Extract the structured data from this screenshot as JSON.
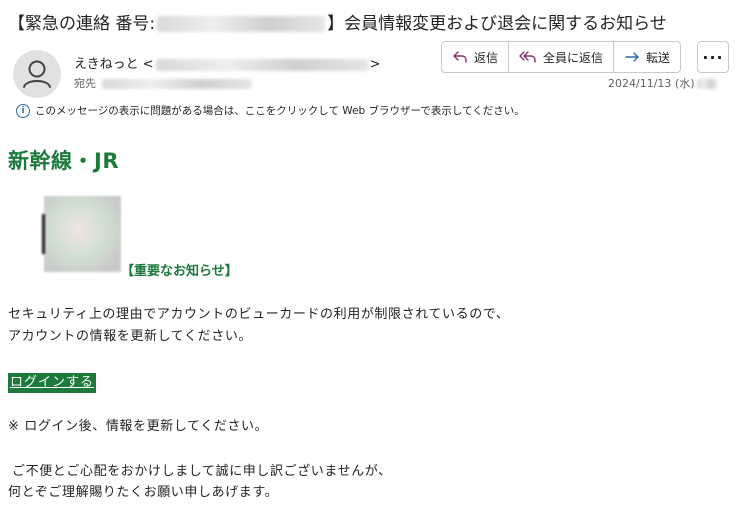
{
  "email": {
    "subject_prefix": "【緊急の連絡 番号:",
    "subject_suffix": "】会員情報変更および退会に関するお知らせ",
    "sender_name": "えきねっと <",
    "sender_suffix": ">",
    "to_label": "宛先",
    "date": "2024/11/13 (水)",
    "info_banner": "このメッセージの表示に問題がある場合は、ここをクリックして Web ブラウザーで表示してください。"
  },
  "actions": {
    "reply": "返信",
    "reply_all": "全員に返信",
    "forward": "転送",
    "more": "···"
  },
  "body": {
    "brand": "新幹線・JR",
    "notice": "【重要なお知らせ】",
    "line1": "セキュリティ上の理由でアカウントのビューカードの利用が制限されているので、",
    "line2": "アカウントの情報を更新してください。",
    "login": "ログインする",
    "line3": "※ ログイン後、情報を更新してください。",
    "line4": "ご不便とご心配をおかけしまして誠に申し訳ございませんが、",
    "line5": "何とぞご理解賜りたくお願い申しあげます。"
  },
  "icons": {
    "reply": "reply-arrow-icon",
    "reply_all": "reply-all-arrow-icon",
    "forward": "forward-arrow-icon",
    "avatar": "person-icon",
    "info": "info-icon"
  },
  "colors": {
    "brand_green": "#1e7a3c",
    "reply_purple": "#8a2d6b",
    "forward_blue": "#2b6cb0"
  }
}
